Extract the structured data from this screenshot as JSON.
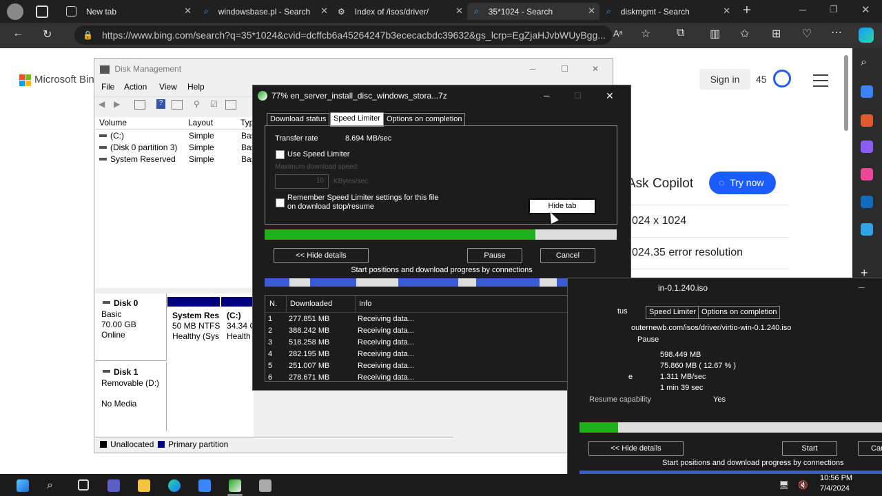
{
  "browser": {
    "tabs": [
      {
        "title": "New tab"
      },
      {
        "title": "windowsbase.pl - Search"
      },
      {
        "title": "Index of /isos/driver/"
      },
      {
        "title": "35*1024 - Search"
      },
      {
        "title": "diskmgmt - Search"
      }
    ],
    "url": "https://www.bing.com/search?q=35*1024&cvid=dcffcb6a45264247b3ececacbdc39632&gs_lcrp=EgZjaHJvbWUyBgg..."
  },
  "bing": {
    "logo": "Microsoft Bing",
    "sign_in": "Sign in",
    "points": "45",
    "copilot_label": "Ask Copilot",
    "try_now": "Try now",
    "suggestions": [
      "024 x 1024",
      "024.35 error resolution"
    ]
  },
  "disk_management": {
    "title": "Disk Management",
    "menu": [
      "File",
      "Action",
      "View",
      "Help"
    ],
    "columns": [
      "Volume",
      "Layout",
      "Typ"
    ],
    "volumes": [
      {
        "name": "(C:)",
        "layout": "Simple",
        "type": "Bas"
      },
      {
        "name": "(Disk 0 partition 3)",
        "layout": "Simple",
        "type": "Bas"
      },
      {
        "name": "System Reserved",
        "layout": "Simple",
        "type": "Bas"
      }
    ],
    "disk0": {
      "name": "Disk 0",
      "type": "Basic",
      "size": "70.00 GB",
      "status": "Online",
      "part1_name": "System Res",
      "part1_detail": "50 MB NTFS",
      "part1_status": "Healthy (Sys",
      "part2_name": "(C:)",
      "part2_detail": "34.34 G",
      "part2_status": "Health"
    },
    "disk1": {
      "name": "Disk 1",
      "type": "Removable (D:)",
      "status": "No Media"
    },
    "legend": [
      "Unallocated",
      "Primary partition"
    ]
  },
  "idm": {
    "title": "77% en_server_install_disc_windows_stora...7z",
    "tabs": [
      "Download status",
      "Speed Limiter",
      "Options on completion"
    ],
    "transfer_rate_label": "Transfer rate",
    "transfer_rate": "8.694  MB/sec",
    "use_speed_limiter": "Use Speed Limiter",
    "max_speed_label": "Maximum download speed:",
    "max_speed_value": "10",
    "max_speed_unit": "KBytes/sec",
    "remember_line1": "Remember Speed Limiter settings for this file",
    "remember_line2": "on download stop/resume",
    "hide_tab": "Hide tab",
    "progress": 0.77,
    "hide_details": "<< Hide details",
    "pause": "Pause",
    "cancel": "Cancel",
    "positions_label": "Start positions and download progress by connections",
    "table_headers": [
      "N.",
      "Downloaded",
      "Info"
    ],
    "rows": [
      {
        "n": "1",
        "downloaded": "277.851  MB",
        "info": "Receiving data..."
      },
      {
        "n": "2",
        "downloaded": "388.242  MB",
        "info": "Receiving data..."
      },
      {
        "n": "3",
        "downloaded": "518.258  MB",
        "info": "Receiving data..."
      },
      {
        "n": "4",
        "downloaded": "282.195  MB",
        "info": "Receiving data..."
      },
      {
        "n": "5",
        "downloaded": "251.007  MB",
        "info": "Receiving data..."
      },
      {
        "n": "6",
        "downloaded": "278.671  MB",
        "info": "Receiving data..."
      }
    ]
  },
  "idm2": {
    "title": "in-0.1.240.iso",
    "tabs": [
      "tus",
      "Speed Limiter",
      "Options on completion"
    ],
    "url": "outernewb.com/isos/driver/virtio-win-0.1.240.iso",
    "status": "Pause",
    "size": "598.449  MB",
    "downloaded": "75.860  MB  ( 12.67 % )",
    "rate": "1.311  MB/sec",
    "time_left": "1 min 39 sec",
    "rate_label_frag": "e",
    "resume_label": "Resume capability",
    "resume_value": "Yes",
    "progress": 0.1267,
    "hide_details": "<< Hide details",
    "start": "Start",
    "cancel_frag": "Car",
    "positions_label": "Start positions and download progress by connections"
  },
  "taskbar": {
    "time": "10:56 PM",
    "date": "7/4/2024"
  },
  "colors": {
    "progress_green": "#1db01d",
    "copilot_blue": "#1a5cff",
    "primary_partition": "#00007f"
  }
}
